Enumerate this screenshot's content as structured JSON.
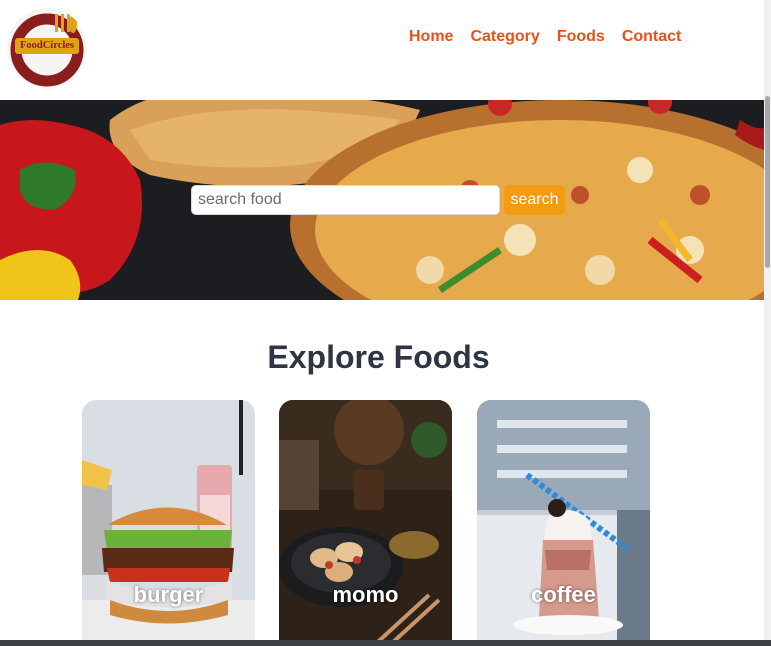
{
  "brand": {
    "logo_text": "FoodCircles"
  },
  "nav": {
    "items": [
      {
        "label": "Home"
      },
      {
        "label": "Category"
      },
      {
        "label": "Foods"
      },
      {
        "label": "Contact"
      }
    ]
  },
  "search": {
    "placeholder": "search food",
    "value": "",
    "button_label": "search"
  },
  "explore": {
    "title": "Explore Foods",
    "cards": [
      {
        "label": "burger"
      },
      {
        "label": "momo"
      },
      {
        "label": "coffee"
      }
    ]
  },
  "colors": {
    "nav_link": "#e8501c",
    "search_button": "#f39c12",
    "section_title": "#2f3542",
    "logo_badge": "#e0a318",
    "logo_ring": "#8a1d1d"
  }
}
